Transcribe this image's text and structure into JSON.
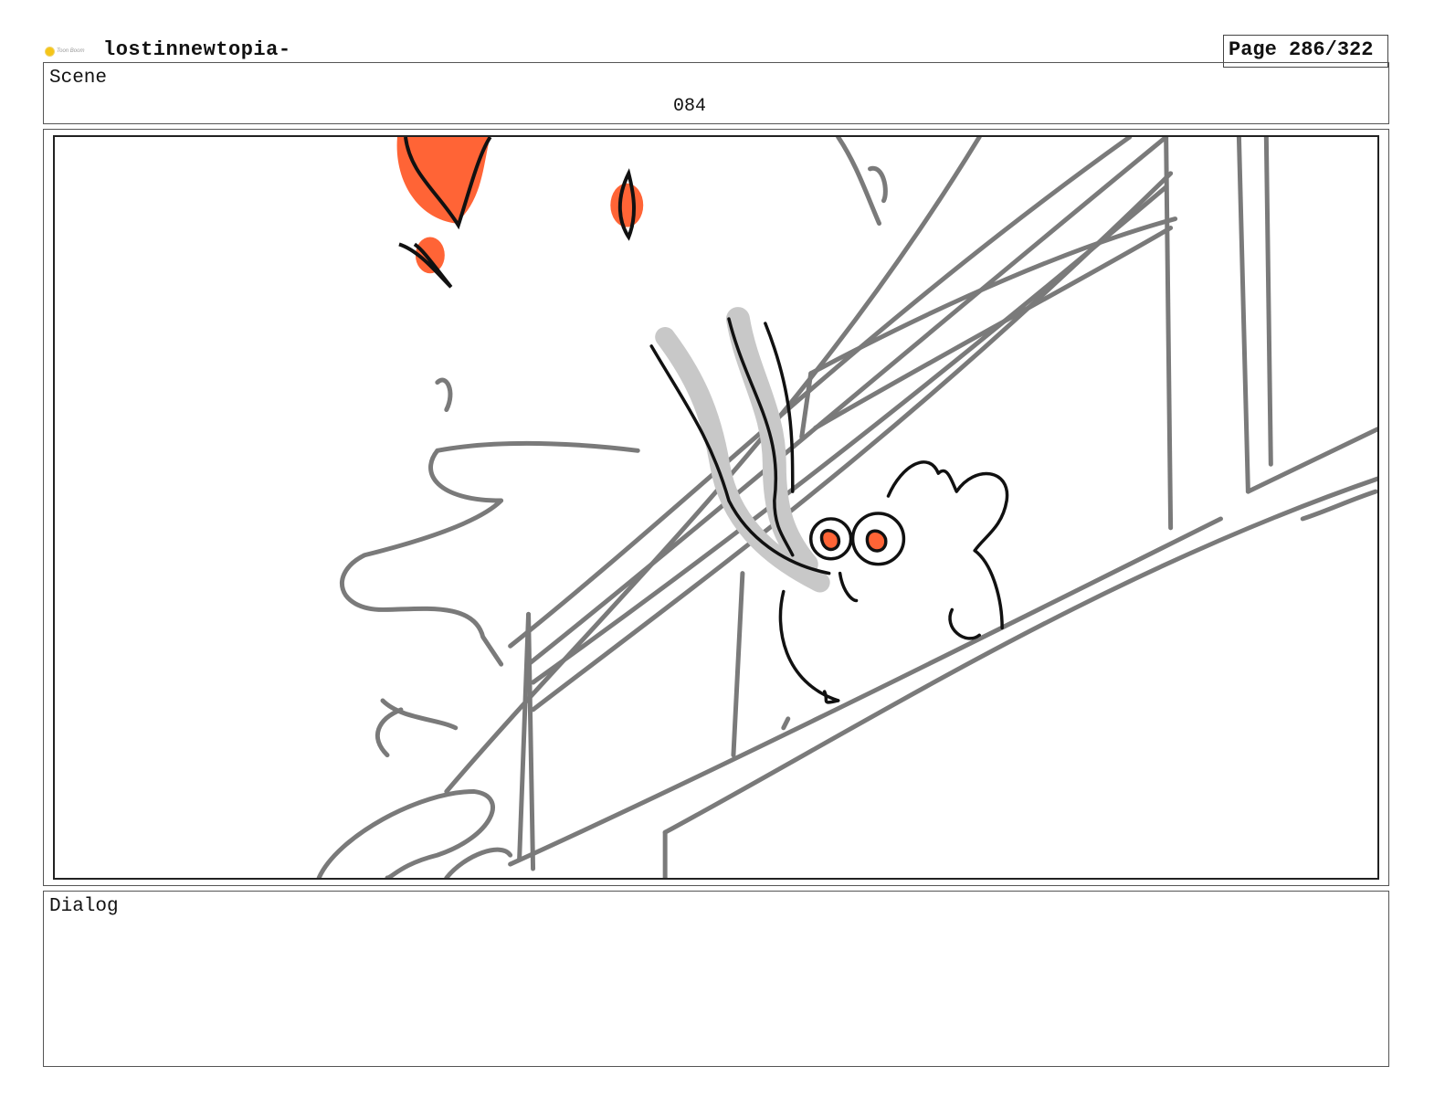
{
  "header": {
    "logo_text": "Toon Boom",
    "project_title": "lostinnewtopia-",
    "page_label": "Page 286/322"
  },
  "scene": {
    "label": "Scene",
    "number": "084"
  },
  "dialog": {
    "label": "Dialog",
    "text": ""
  },
  "colors": {
    "accent": "#ff6436",
    "sketch_gray": "#7a7a7a",
    "ink": "#111111",
    "smoke": "#c8c8c8"
  }
}
